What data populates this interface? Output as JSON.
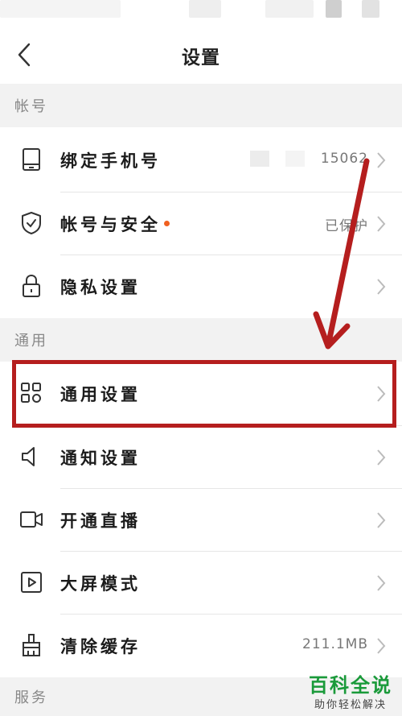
{
  "header": {
    "title": "设置"
  },
  "sections": {
    "account": "帐号",
    "general": "通用",
    "service": "服务"
  },
  "rows": [
    {
      "label": "绑定手机号",
      "value": "15062",
      "icon": "phone-icon"
    },
    {
      "label": "帐号与安全",
      "value": "已保护",
      "icon": "shield-icon"
    },
    {
      "label": "隐私设置",
      "value": "",
      "icon": "lock-icon"
    },
    {
      "label": "通用设置",
      "value": "",
      "icon": "grid-icon"
    },
    {
      "label": "通知设置",
      "value": "",
      "icon": "speaker-icon"
    },
    {
      "label": "开通直播",
      "value": "",
      "icon": "camera-icon"
    },
    {
      "label": "大屏模式",
      "value": "",
      "icon": "play-screen-icon"
    },
    {
      "label": "清除缓存",
      "value": "211.1MB",
      "icon": "broom-icon"
    }
  ],
  "watermark": {
    "title": "百科全说",
    "subtitle": "助你轻松解决"
  },
  "colors": {
    "highlight": "#b51e1e",
    "dot": "#f06020",
    "watermark": "#1a9a3a",
    "section_bg": "#f2f2f2"
  }
}
